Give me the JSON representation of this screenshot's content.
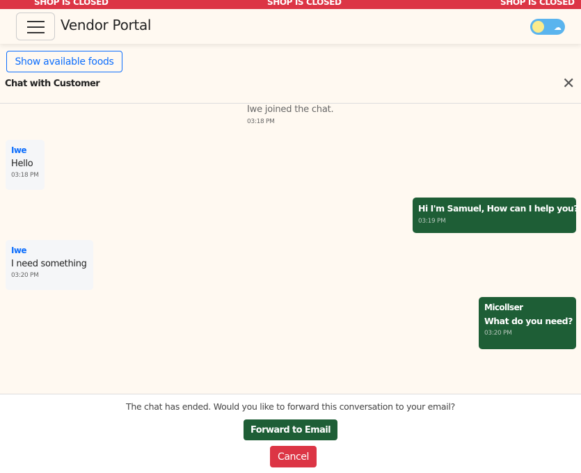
{
  "banner": {
    "text": "SHOP IS CLOSED"
  },
  "navbar": {
    "brand": "Vendor Portal"
  },
  "toolbar": {
    "show_foods_label": "Show available foods"
  },
  "chat": {
    "title": "Chat with Customer",
    "close_symbol": "✕",
    "system_message": {
      "text": "Iwe joined the chat.",
      "time": "03:18 PM"
    },
    "messages": [
      {
        "direction": "incoming",
        "sender": "Iwe",
        "text": "Hello",
        "time": "03:18 PM"
      },
      {
        "direction": "outgoing",
        "sender": "",
        "text": "Hi I'm Samuel, How can I help you?",
        "time": "03:19 PM"
      },
      {
        "direction": "incoming",
        "sender": "Iwe",
        "text": "I need something",
        "time": "03:20 PM"
      },
      {
        "direction": "outgoing",
        "sender": "Micollser",
        "text": "What do you need?",
        "time": "03:20 PM"
      }
    ]
  },
  "footer": {
    "ended_text": "The chat has ended. Would you like to forward this conversation to your email?",
    "forward_label": "Forward to Email",
    "cancel_label": "Cancel"
  },
  "colors": {
    "banner": "#dc3545",
    "background": "#fff9f1",
    "accent_blue": "#0d6efd",
    "outgoing_bubble": "#1e5e36",
    "cancel": "#dc3545"
  },
  "icons": {
    "menu": "hamburger-icon",
    "theme": "theme-toggle-icon",
    "close": "close-icon"
  }
}
